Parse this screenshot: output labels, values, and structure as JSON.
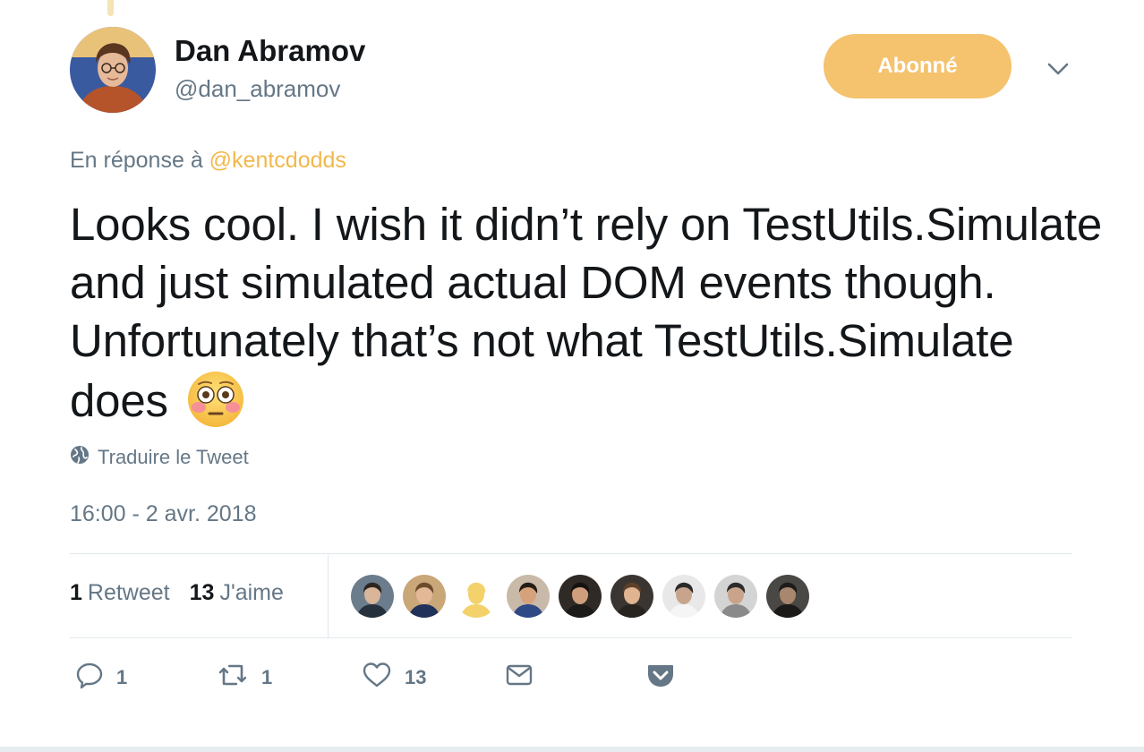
{
  "author": {
    "name": "Dan Abramov",
    "handle": "@dan_abramov"
  },
  "follow_button": {
    "label": "Abonné"
  },
  "reply_to": {
    "prefix": "En réponse à ",
    "mention": "@kentcdodds"
  },
  "tweet": {
    "text": "Looks cool. I wish it didn’t rely on TestUtils.Simulate and just simulated actual DOM events though. Unfortunately that’s not what TestUtils.Simulate does",
    "emoji": "flushed-face"
  },
  "translate": {
    "label": "Traduire le Tweet"
  },
  "timestamp": "16:00 - 2 avr. 2018",
  "stats": {
    "retweets_count": "1",
    "retweets_label": "Retweet",
    "likes_count": "13",
    "likes_label": "J'aime"
  },
  "likers": [
    {
      "bg": "#6b7d8c",
      "skin": "#d9b59a",
      "hair": "#2b2622",
      "shirt": "#25313d"
    },
    {
      "bg": "#c9a778",
      "skin": "#e2b897",
      "hair": "#6c4b2c",
      "shirt": "#21325a"
    },
    {
      "bg": "#ffffff",
      "skin": "#f4d26b",
      "hair": "#f4d26b",
      "shirt": "#f4d26b"
    },
    {
      "bg": "#c9b9a9",
      "skin": "#d6a27c",
      "hair": "#231c17",
      "shirt": "#2d4a86"
    },
    {
      "bg": "#2f2a26",
      "skin": "#cf9f7d",
      "hair": "#151210",
      "shirt": "#1d1b19"
    },
    {
      "bg": "#3a3530",
      "skin": "#e0b391",
      "hair": "#5c4128",
      "shirt": "#27231f"
    },
    {
      "bg": "#e8e8e8",
      "skin": "#c7a58d",
      "hair": "#2a2a2a",
      "shirt": "#f5f5f5"
    },
    {
      "bg": "#d4d4d4",
      "skin": "#c9a48b",
      "hair": "#2b2b2b",
      "shirt": "#8a8a8a"
    },
    {
      "bg": "#4a4845",
      "skin": "#a9876f",
      "hair": "#1e1c1a",
      "shirt": "#1b1a19"
    }
  ],
  "actions": {
    "replies_count": "1",
    "retweets_count": "1",
    "likes_count": "13"
  },
  "colors": {
    "accent": "#f5c26e",
    "mention": "#f2b84b",
    "secondary_text": "#657786",
    "primary_text": "#14171a",
    "border": "#e1e8ed"
  }
}
